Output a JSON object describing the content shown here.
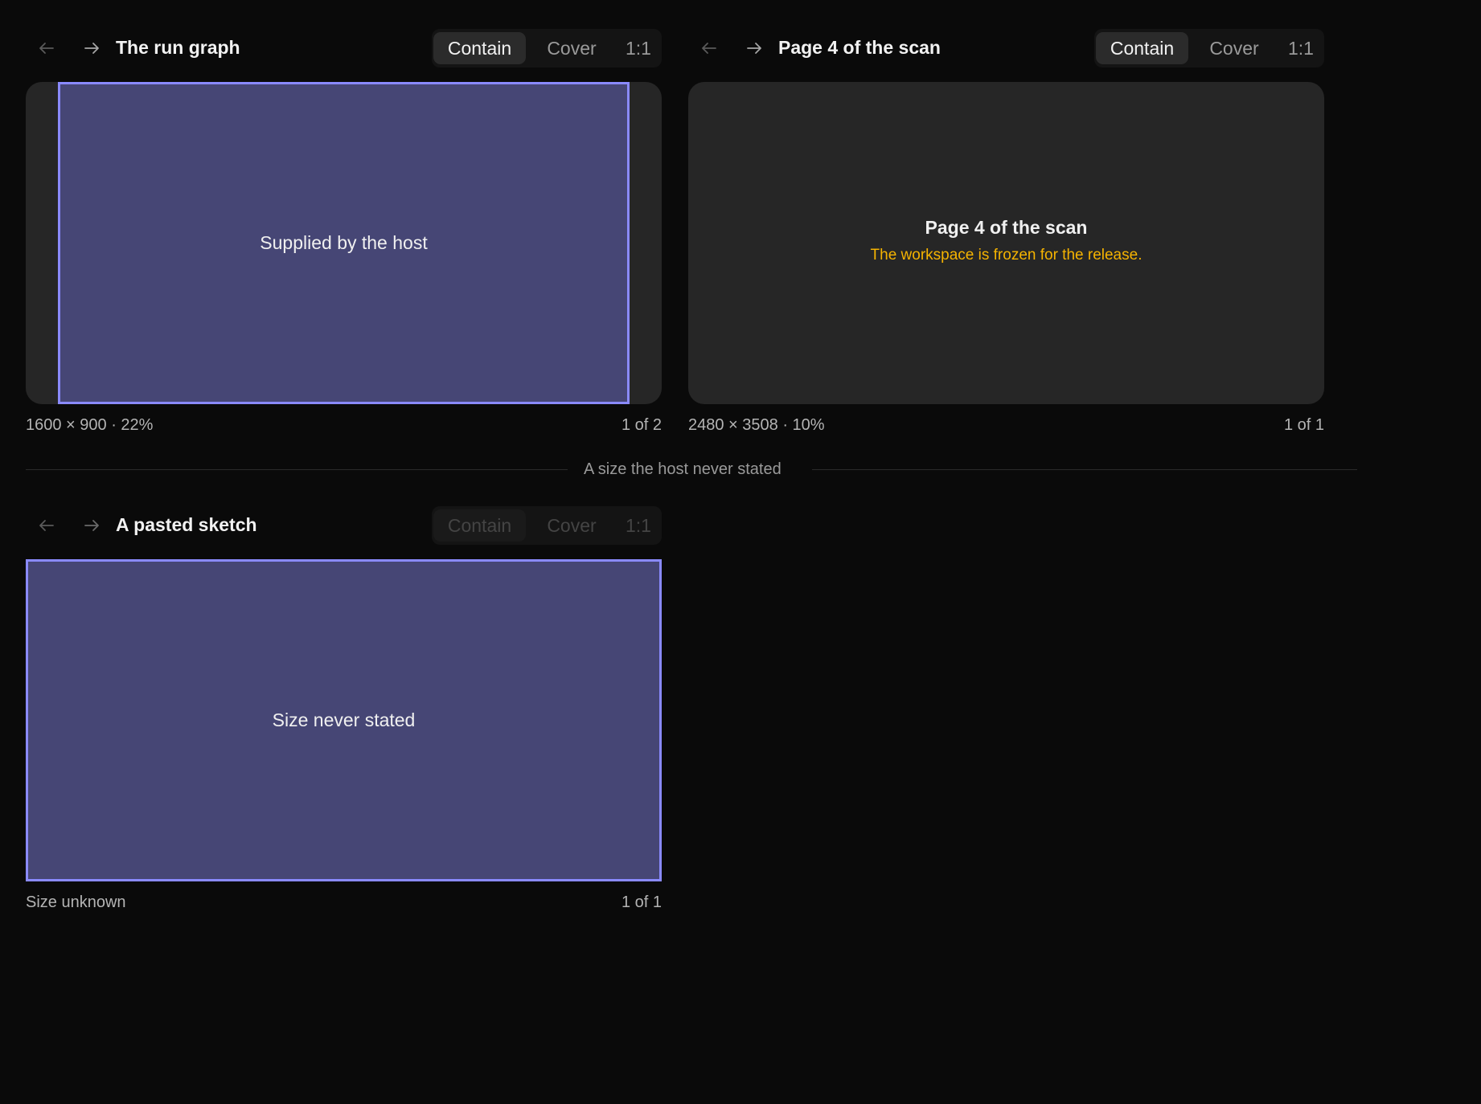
{
  "viewers": [
    {
      "nav": {
        "back_icon": "arrow-left-icon",
        "forward_icon": "arrow-right-icon"
      },
      "title": "The run graph",
      "fit_modes": [
        "Contain",
        "Cover",
        "1:1"
      ],
      "active_fit": "Contain",
      "image_label": "Supplied by the host",
      "dimensions": "1600 × 900 · 22%",
      "counter": "1 of 2"
    },
    {
      "nav": {
        "back_icon": "arrow-left-icon",
        "forward_icon": "arrow-right-icon"
      },
      "title": "Page 4 of the scan",
      "fit_modes": [
        "Contain",
        "Cover",
        "1:1"
      ],
      "active_fit": "Contain",
      "stage_title": "Page 4 of the scan",
      "stage_warning": "The workspace is frozen for the release.",
      "dimensions": "2480 × 3508 · 10%",
      "counter": "1 of 1"
    },
    {
      "nav": {
        "back_icon": "arrow-left-icon",
        "forward_icon": "arrow-right-icon"
      },
      "title": "A pasted sketch",
      "fit_modes": [
        "Contain",
        "Cover",
        "1:1"
      ],
      "active_fit": "Contain",
      "fit_disabled": true,
      "image_label": "Size never stated",
      "dimensions": "Size unknown",
      "counter": "1 of 1"
    }
  ],
  "section_divider": {
    "label": "A size the host never stated"
  },
  "colors": {
    "background": "#0a0a0a",
    "stage": "#262626",
    "image_fill": "#464675",
    "image_border": "#8a8aff",
    "warning": "#f5b301"
  }
}
